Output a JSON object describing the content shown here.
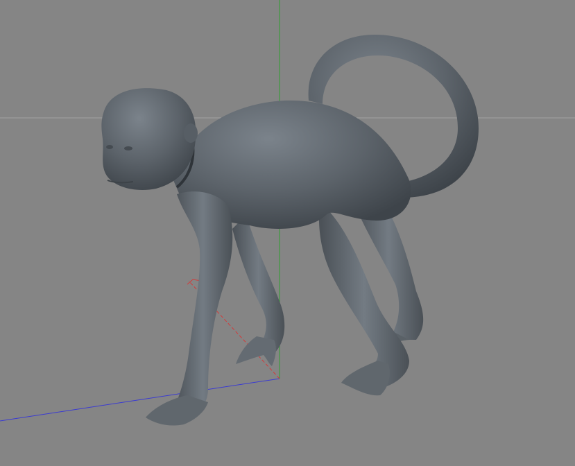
{
  "viewport": {
    "background": "#858585",
    "horizon_color": "#a8a8a8",
    "axis_colors": {
      "x": "#d23a3a",
      "y": "#2fa02f",
      "z": "#3a3ad2"
    },
    "model_color": "#5d646b"
  }
}
